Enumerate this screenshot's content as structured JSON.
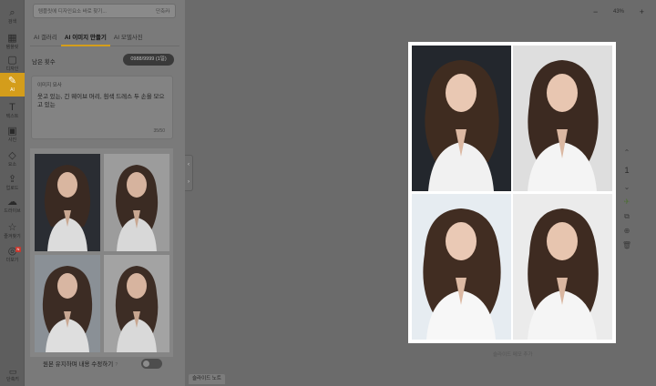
{
  "rail": [
    {
      "name": "rail-search",
      "icon": "⌕",
      "label": "검색",
      "active": false
    },
    {
      "name": "rail-template",
      "icon": "▦",
      "label": "템플릿",
      "active": false
    },
    {
      "name": "rail-design",
      "icon": "▢",
      "label": "디자인",
      "active": false
    },
    {
      "name": "rail-ai",
      "icon": "✎",
      "label": "AI",
      "active": true
    },
    {
      "name": "rail-text",
      "icon": "T",
      "label": "텍스트",
      "active": false
    },
    {
      "name": "rail-photo",
      "icon": "▣",
      "label": "사진",
      "active": false
    },
    {
      "name": "rail-element",
      "icon": "◇",
      "label": "요소",
      "active": false
    },
    {
      "name": "rail-upload",
      "icon": "⇪",
      "label": "업로드",
      "active": false
    },
    {
      "name": "rail-drive",
      "icon": "☁",
      "label": "드라이브",
      "active": false
    },
    {
      "name": "rail-favorite",
      "icon": "☆",
      "label": "즐겨찾기",
      "active": false
    },
    {
      "name": "rail-more",
      "icon": "◎",
      "label": "더보기",
      "active": false
    }
  ],
  "search": {
    "placeholder": "템플릿에 디자인요소 바로 찾기...",
    "more": "···",
    "shortcut": "단축키"
  },
  "tabs": [
    {
      "label": "AI 갤러리",
      "active": false
    },
    {
      "label": "AI 이미지 만들기",
      "active": true
    },
    {
      "label": "AI 모델사진",
      "active": false
    }
  ],
  "remaining": {
    "label": "남은 횟수",
    "value": "0988/9999 (1일)"
  },
  "description": {
    "title": "이미지 묘사",
    "text": "웃고 있는, 긴 웨이브 머리, 흰색 드레스 두 손을 모으고 있는",
    "count": "35/50"
  },
  "edit": {
    "label": "원본 유지하며 내용 수정하기",
    "help": "?",
    "enabled": false
  },
  "bottom_tool": {
    "icon": "▭",
    "label": "단축키"
  },
  "slide_notes": {
    "label": "슬라이드 노트"
  },
  "zoom": {
    "minus": "−",
    "value": "43%",
    "plus": "+"
  },
  "slide_caption": "슬라이드 메모 추가",
  "page_number": "1",
  "colors": {
    "accent": "#d49d1b",
    "canvas_bg": "#6b6b6b",
    "panel_bg": "#7a7a7a"
  }
}
